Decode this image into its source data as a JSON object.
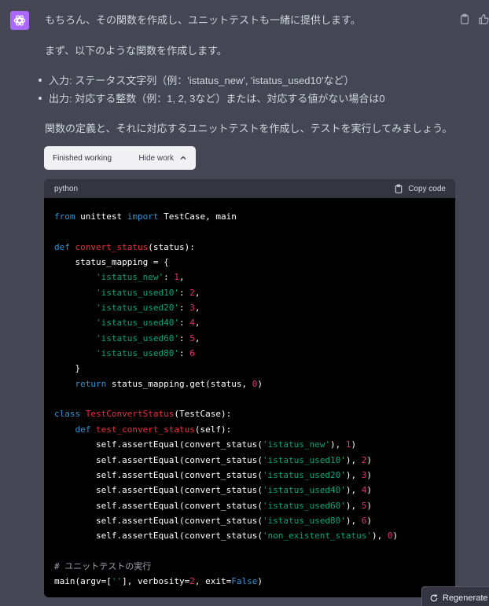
{
  "message": {
    "intro": "もちろん、その関数を作成し、ユニットテストも一緒に提供します。",
    "spec_intro": "まず、以下のような関数を作成します。",
    "bullets": [
      "入力: ステータス文字列（例：'istatus_new', 'istatus_used10'など）",
      "出力: 対応する整数（例：1, 2, 3など）または、対応する値がない場合は0"
    ],
    "outro": "関数の定義と、それに対応するユニットテストを作成し、テストを実行してみましょう。"
  },
  "work_pill": {
    "status": "Finished working",
    "toggle_label": "Hide work"
  },
  "code": {
    "language": "python",
    "copy_label": "Copy code",
    "lines": [
      "from unittest import TestCase, main",
      "",
      "def convert_status(status):",
      "    status_mapping = {",
      "        'istatus_new': 1,",
      "        'istatus_used10': 2,",
      "        'istatus_used20': 3,",
      "        'istatus_used40': 4,",
      "        'istatus_used60': 5,",
      "        'istatus_used80': 6",
      "    }",
      "    return status_mapping.get(status, 0)",
      "",
      "class TestConvertStatus(TestCase):",
      "    def test_convert_status(self):",
      "        self.assertEqual(convert_status('istatus_new'), 1)",
      "        self.assertEqual(convert_status('istatus_used10'), 2)",
      "        self.assertEqual(convert_status('istatus_used20'), 3)",
      "        self.assertEqual(convert_status('istatus_used40'), 4)",
      "        self.assertEqual(convert_status('istatus_used60'), 5)",
      "        self.assertEqual(convert_status('istatus_used80'), 6)",
      "        self.assertEqual(convert_status('non_existent_status'), 0)",
      "",
      "# ユニットテストの実行",
      "main(argv=[''], verbosity=2, exit=False)"
    ]
  },
  "regenerate_label": "Regenerate",
  "icons": {
    "avatar": "openai-logo-icon",
    "copy": "clipboard-icon",
    "feedback": "thumbs-up-icon",
    "toggle": "chevron-up-icon",
    "regenerate": "refresh-icon"
  },
  "colors": {
    "background": "#444654",
    "avatar": "#ab68ff",
    "code_bg": "#000000",
    "keyword": "#2e95d3",
    "function": "#f22c3d",
    "string": "#00a67d",
    "number": "#df3079"
  }
}
